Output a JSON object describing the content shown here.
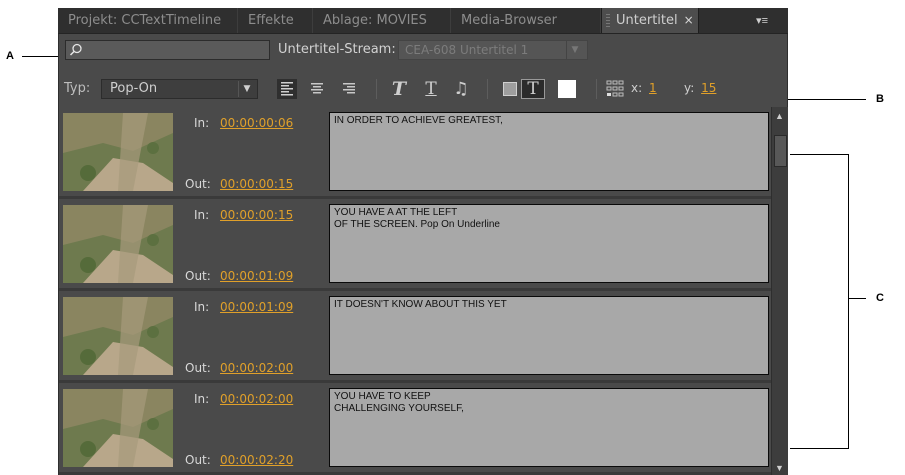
{
  "callouts": {
    "a": "A",
    "b": "B",
    "c": "C"
  },
  "tabs": [
    {
      "label": "Projekt: CCTextTimeline"
    },
    {
      "label": "Effekte"
    },
    {
      "label": "Ablage: MOVIES"
    },
    {
      "label": "Media-Browser"
    },
    {
      "label": "Untertitel"
    }
  ],
  "close_glyph": "×",
  "panel_menu_glyph": "▾≡",
  "search": {
    "placeholder": "",
    "value": "",
    "icon": "magnifier-icon"
  },
  "stream": {
    "label": "Untertitel-Stream:",
    "value": "CEA-608 Untertitel 1"
  },
  "toolbar": {
    "typ_label": "Typ:",
    "typ_value": "Pop-On",
    "x_label": "x:",
    "x_value": "1",
    "y_label": "y:",
    "y_value": "15",
    "italic_glyph": "T",
    "underline_glyph": "T",
    "music_glyph": "♫",
    "bg_glyph": "T"
  },
  "captions": [
    {
      "in_label": "In:",
      "in": "00:00:00:06",
      "out_label": "Out:",
      "out": "00:00:00:15",
      "text": "IN ORDER TO ACHIEVE GREATEST,"
    },
    {
      "in_label": "In:",
      "in": "00:00:00:15",
      "out_label": "Out:",
      "out": "00:00:01:09",
      "text": "YOU HAVE A AT THE LEFT\nOF THE SCREEN. Pop On Underline"
    },
    {
      "in_label": "In:",
      "in": "00:00:01:09",
      "out_label": "Out:",
      "out": "00:00:02:00",
      "text": "IT DOESN'T KNOW ABOUT THIS YET"
    },
    {
      "in_label": "In:",
      "in": "00:00:02:00",
      "out_label": "Out:",
      "out": "00:00:02:20",
      "text": "YOU HAVE TO KEEP\nCHALLENGING YOURSELF,"
    }
  ],
  "colors": {
    "accent_timecode": "#e0a02a",
    "panel_bg": "#4a4a4a",
    "caption_box": "#a8a8a8"
  }
}
